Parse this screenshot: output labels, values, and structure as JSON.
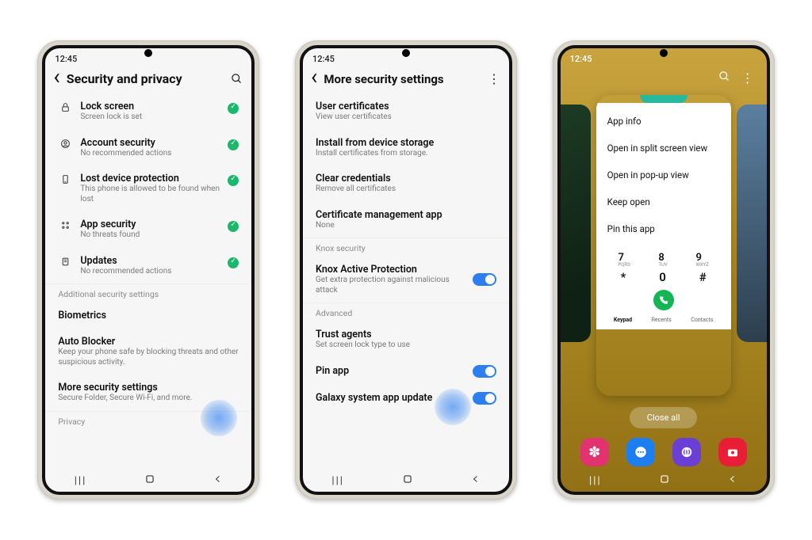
{
  "status_time": "12:45",
  "phone1": {
    "title": "Security and privacy",
    "items": [
      {
        "title": "Lock screen",
        "sub": "Screen lock is set"
      },
      {
        "title": "Account security",
        "sub": "No recommended actions"
      },
      {
        "title": "Lost device protection",
        "sub": "This phone is allowed to be found when lost"
      },
      {
        "title": "App security",
        "sub": "No threats found"
      },
      {
        "title": "Updates",
        "sub": "No recommended actions"
      }
    ],
    "section_additional": "Additional security settings",
    "biometrics": "Biometrics",
    "autoblocker_title": "Auto Blocker",
    "autoblocker_sub": "Keep your phone safe by blocking threats and other suspicious activity.",
    "more_title": "More security settings",
    "more_sub": "Secure Folder, Secure Wi-Fi, and more.",
    "privacy_label": "Privacy"
  },
  "phone2": {
    "title": "More security settings",
    "items_top": [
      {
        "title": "User certificates",
        "sub": "View user certificates"
      },
      {
        "title": "Install from device storage",
        "sub": "Install certificates from storage."
      },
      {
        "title": "Clear credentials",
        "sub": "Remove all certificates"
      },
      {
        "title": "Certificate management app",
        "sub": "None"
      }
    ],
    "section_knox": "Knox security",
    "knox_title": "Knox Active Protection",
    "knox_sub": "Get extra protection against malicious attack",
    "section_advanced": "Advanced",
    "trust_title": "Trust agents",
    "trust_sub": "Set screen lock type to use",
    "pin_title": "Pin app",
    "galaxy_title": "Galaxy system app update"
  },
  "phone3": {
    "menu": [
      "App info",
      "Open in split screen view",
      "Open in pop-up view",
      "Keep open",
      "Pin this app"
    ],
    "dial": {
      "row1": [
        {
          "n": "7",
          "s": "PQRS"
        },
        {
          "n": "8",
          "s": "TUV"
        },
        {
          "n": "9",
          "s": "WXYZ"
        }
      ],
      "row2": [
        "*",
        "0",
        "#"
      ],
      "tabs": [
        "Keypad",
        "Recents",
        "Contacts"
      ]
    },
    "close_all": "Close all"
  }
}
